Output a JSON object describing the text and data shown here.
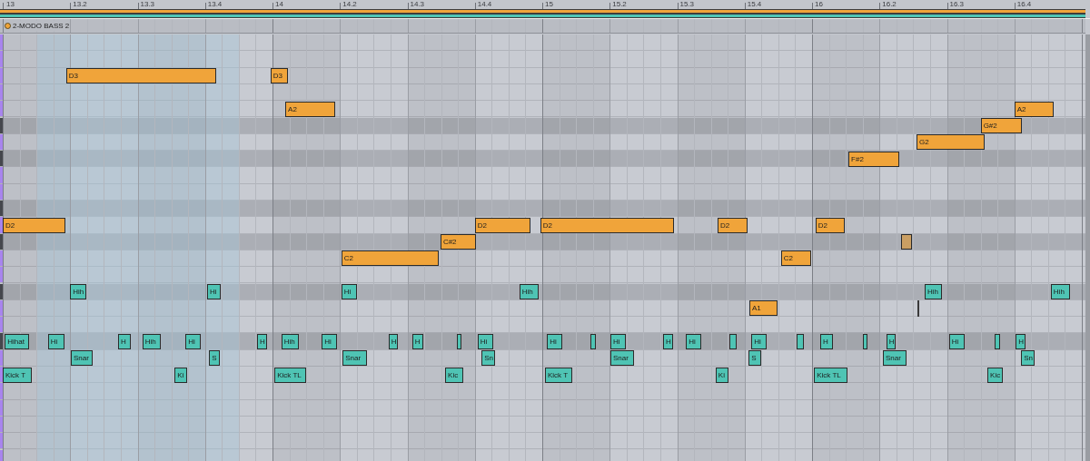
{
  "ruler": {
    "labels": [
      "13",
      "13.2",
      "13.3",
      "13.4",
      "14",
      "14.2",
      "14.3",
      "14.4",
      "15",
      "15.2",
      "15.3",
      "15.4",
      "16",
      "16.2",
      "16.3",
      "16.4"
    ]
  },
  "clips": [
    {
      "color": "#f0a43a"
    },
    {
      "color": "#4fc4b4"
    }
  ],
  "track": {
    "name": "2-MODO BASS 2"
  },
  "lanes": [
    {
      "black_key": false
    },
    {
      "black_key": false
    },
    {
      "black_key": false,
      "color": "#f0a43a",
      "notes": [
        {
          "label": "D3"
        },
        {
          "label": "D3"
        }
      ]
    },
    {
      "black_key": false
    },
    {
      "black_key": false,
      "color": "#f0a43a",
      "notes": [
        {
          "label": "A2"
        },
        {
          "label": "A2"
        }
      ]
    },
    {
      "black_key": true,
      "color": "#f0a43a",
      "notes": [
        {
          "label": "G#2"
        }
      ]
    },
    {
      "black_key": false,
      "color": "#f0a43a",
      "notes": [
        {
          "label": "G2"
        }
      ]
    },
    {
      "black_key": true,
      "color": "#f0a43a",
      "notes": [
        {
          "label": "F#2"
        }
      ]
    },
    {
      "black_key": false
    },
    {
      "black_key": false
    },
    {
      "black_key": true
    },
    {
      "black_key": false,
      "color": "#f0a43a",
      "notes": [
        {
          "label": "D2"
        },
        {
          "label": "D2"
        },
        {
          "label": "D2"
        },
        {
          "label": "D2"
        },
        {
          "label": "D2"
        }
      ]
    },
    {
      "black_key": true,
      "color": "#f0a43a",
      "notes": [
        {
          "label": "C#2",
          "dimmed": false
        },
        {
          "dimmed": true
        }
      ]
    },
    {
      "black_key": false,
      "color": "#f0a43a",
      "notes": [
        {
          "label": "C2"
        },
        {
          "label": "C2"
        }
      ]
    },
    {
      "black_key": false
    },
    {
      "black_key": true,
      "color": "#4fc4b4",
      "notes": [
        {
          "label": "Hih"
        },
        {
          "label": "Hi"
        },
        {
          "label": "Hi"
        },
        {
          "label": "Hih"
        },
        {
          "label": "Hih"
        },
        {
          "label": "Hih"
        }
      ]
    },
    {
      "black_key": false,
      "color": "#f0a43a",
      "notes": [
        {
          "label": "A1"
        }
      ]
    },
    {
      "black_key": false
    },
    {
      "black_key": true,
      "color": "#4fc4b4",
      "notes": [
        {
          "kind": "labeled",
          "label": "Hihat"
        },
        {
          "kind": "labeled",
          "label": "Hi"
        },
        {
          "kind": "labeled",
          "label": "H"
        },
        {
          "kind": "labeled",
          "label": "Hih"
        },
        {
          "kind": "labeled",
          "label": "Hi"
        },
        {
          "kind": "labeled",
          "label": "H"
        },
        {
          "kind": "labeled",
          "label": "Hih"
        },
        {
          "kind": "labeled",
          "label": "Hi"
        },
        {
          "kind": "labeled",
          "label": "H"
        },
        {
          "kind": "labeled",
          "label": "H"
        },
        {
          "kind": "sliver"
        },
        {
          "kind": "labeled",
          "label": "Hi"
        },
        {
          "kind": "labeled",
          "label": "Hi"
        },
        {
          "kind": "sliver"
        },
        {
          "kind": "labeled",
          "label": "Hi"
        },
        {
          "kind": "labeled",
          "label": "H"
        },
        {
          "kind": "labeled",
          "label": "Hi"
        },
        {
          "kind": "sliver"
        },
        {
          "kind": "labeled",
          "label": "Hi"
        },
        {
          "kind": "sliver"
        },
        {
          "kind": "labeled",
          "label": "H"
        },
        {
          "kind": "sliver"
        },
        {
          "kind": "labeled",
          "label": "H"
        },
        {
          "kind": "labeled",
          "label": "Hi"
        },
        {
          "kind": "sliver"
        },
        {
          "kind": "labeled",
          "label": "H"
        }
      ]
    },
    {
      "black_key": false,
      "color": "#4fc4b4",
      "notes": [
        {
          "label": "Snar"
        },
        {
          "label": "S"
        },
        {
          "label": "Snar"
        },
        {
          "label": "Sn"
        },
        {
          "label": "Snar"
        },
        {
          "label": "S"
        },
        {
          "label": "Snar"
        },
        {
          "label": "Sn"
        }
      ]
    },
    {
      "black_key": false,
      "color": "#4fc4b4",
      "notes": [
        {
          "label": "Kick T"
        },
        {
          "label": "Ki"
        },
        {
          "label": "Kick TL"
        },
        {
          "label": "Kic"
        },
        {
          "label": "Kick T"
        },
        {
          "label": "Ki"
        },
        {
          "label": "Kick TL"
        },
        {
          "label": "Kic"
        }
      ]
    },
    {
      "black_key": false
    },
    {
      "black_key": false
    },
    {
      "black_key": false
    },
    {
      "black_key": false
    },
    {
      "black_key": false
    }
  ]
}
